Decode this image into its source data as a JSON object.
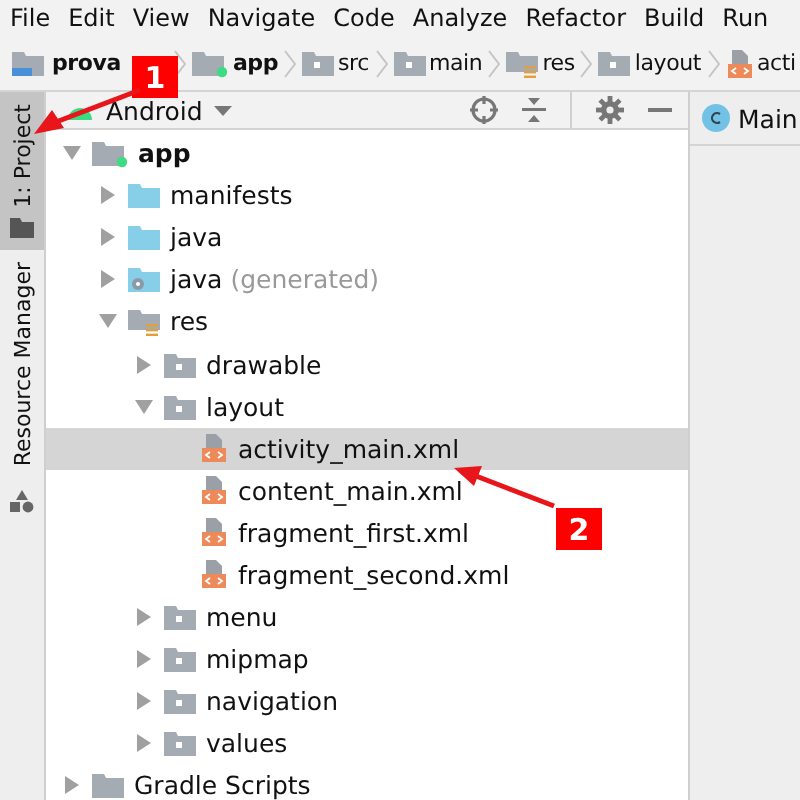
{
  "menu": [
    "File",
    "Edit",
    "View",
    "Navigate",
    "Code",
    "Analyze",
    "Refactor",
    "Build",
    "Run"
  ],
  "breadcrumb": [
    {
      "label": "prova",
      "kind": "project"
    },
    {
      "label": "app",
      "kind": "module"
    },
    {
      "label": "src",
      "kind": "folder"
    },
    {
      "label": "main",
      "kind": "folder"
    },
    {
      "label": "res",
      "kind": "res"
    },
    {
      "label": "layout",
      "kind": "folder"
    },
    {
      "label": "acti",
      "kind": "xml"
    }
  ],
  "side_tabs": [
    {
      "label": "1: Project",
      "selected": true
    },
    {
      "label": "Resource Manager",
      "selected": false
    }
  ],
  "toolbar": {
    "view": "Android"
  },
  "editor_tab": {
    "label": "Main"
  },
  "tree": [
    {
      "label": "app",
      "kind": "module",
      "expanded": true,
      "selected": false,
      "children": [
        {
          "label": "manifests",
          "kind": "source",
          "expanded": false,
          "selected": false
        },
        {
          "label": "java",
          "kind": "source",
          "expanded": false,
          "selected": false
        },
        {
          "label": "java",
          "note": "(generated)",
          "kind": "generated",
          "expanded": false,
          "selected": false
        },
        {
          "label": "res",
          "kind": "res",
          "expanded": true,
          "selected": false,
          "children": [
            {
              "label": "drawable",
              "kind": "folder",
              "expanded": false,
              "selected": false
            },
            {
              "label": "layout",
              "kind": "folder",
              "expanded": true,
              "selected": false,
              "children": [
                {
                  "label": "activity_main.xml",
                  "kind": "xml",
                  "selected": true
                },
                {
                  "label": "content_main.xml",
                  "kind": "xml",
                  "selected": false
                },
                {
                  "label": "fragment_first.xml",
                  "kind": "xml",
                  "selected": false
                },
                {
                  "label": "fragment_second.xml",
                  "kind": "xml",
                  "selected": false
                }
              ]
            },
            {
              "label": "menu",
              "kind": "folder",
              "expanded": false,
              "selected": false
            },
            {
              "label": "mipmap",
              "kind": "folder",
              "expanded": false,
              "selected": false
            },
            {
              "label": "navigation",
              "kind": "folder",
              "expanded": false,
              "selected": false
            },
            {
              "label": "values",
              "kind": "folder",
              "expanded": false,
              "selected": false
            }
          ]
        }
      ]
    },
    {
      "label": "Gradle Scripts",
      "kind": "gradle",
      "expanded": false,
      "selected": false
    }
  ],
  "annotations": [
    {
      "label": "1"
    },
    {
      "label": "2"
    }
  ]
}
